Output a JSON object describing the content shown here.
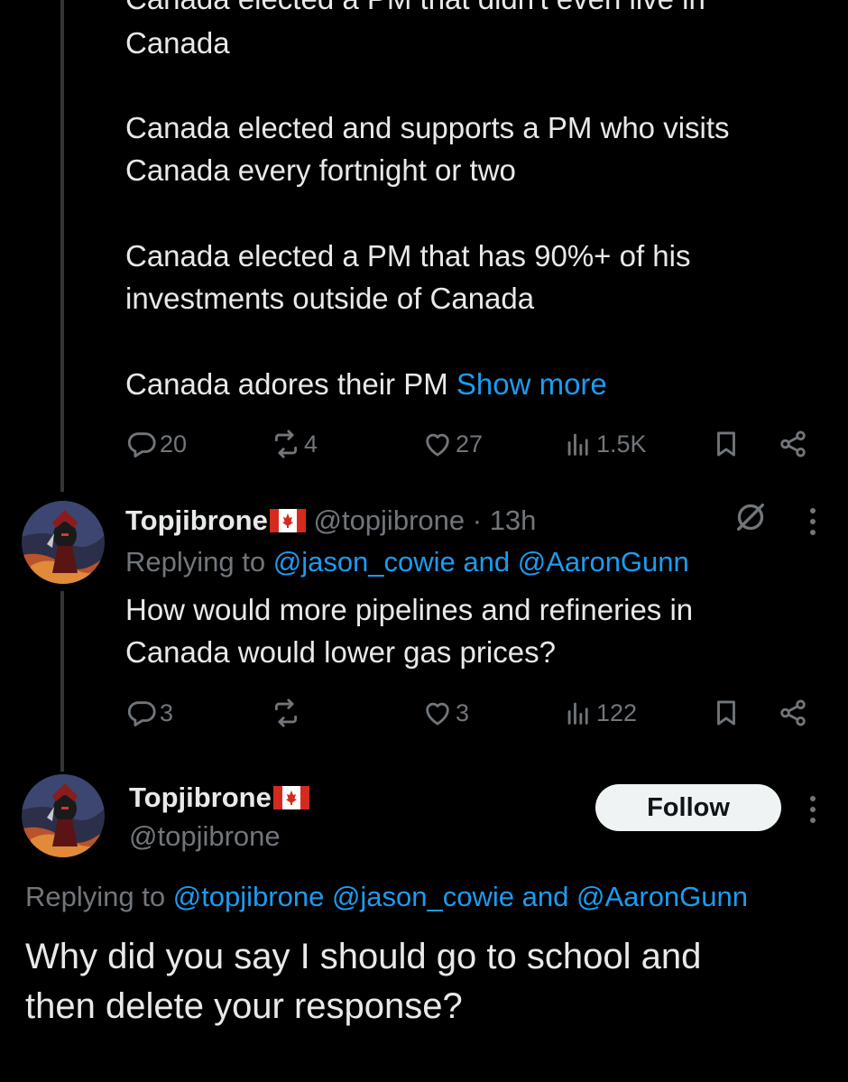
{
  "tweet1": {
    "lines": [
      "Canada elected a PM that didn't even live in",
      "Canada",
      "Canada elected and supports a PM who visits",
      "Canada every fortnight or two",
      "Canada elected a PM that has 90%+ of his",
      "investments outside of Canada",
      "Canada adores their PM"
    ],
    "show_more": "Show more",
    "replies": "20",
    "retweets": "4",
    "likes": "27",
    "views": "1.5K"
  },
  "tweet2": {
    "name": "Topjibrone",
    "handle": "@topjibrone",
    "separator": "·",
    "time": "13h",
    "replying_prefix": "Replying to",
    "replying_to": "@jason_cowie and @AaronGunn",
    "lines": [
      "How would more pipelines and refineries in",
      "Canada would lower gas prices?"
    ],
    "replies": "3",
    "retweets": "",
    "likes": "3",
    "views": "122"
  },
  "tweet3": {
    "name": "Topjibrone",
    "handle": "@topjibrone",
    "follow_label": "Follow",
    "replying_prefix": "Replying to",
    "replying_to": "@topjibrone @jason_cowie and @AaronGunn",
    "lines": [
      "Why did you say I should go to school and",
      "then delete your response?"
    ]
  },
  "colors": {
    "background": "#000000",
    "text": "#e7e9ea",
    "muted": "#71767b",
    "link": "#1d9bf0",
    "thread_line": "#333639"
  },
  "icons": [
    "reply-icon",
    "retweet-icon",
    "like-icon",
    "views-icon",
    "bookmark-icon",
    "share-icon",
    "grok-icon",
    "more-icon",
    "canada-flag-icon"
  ]
}
